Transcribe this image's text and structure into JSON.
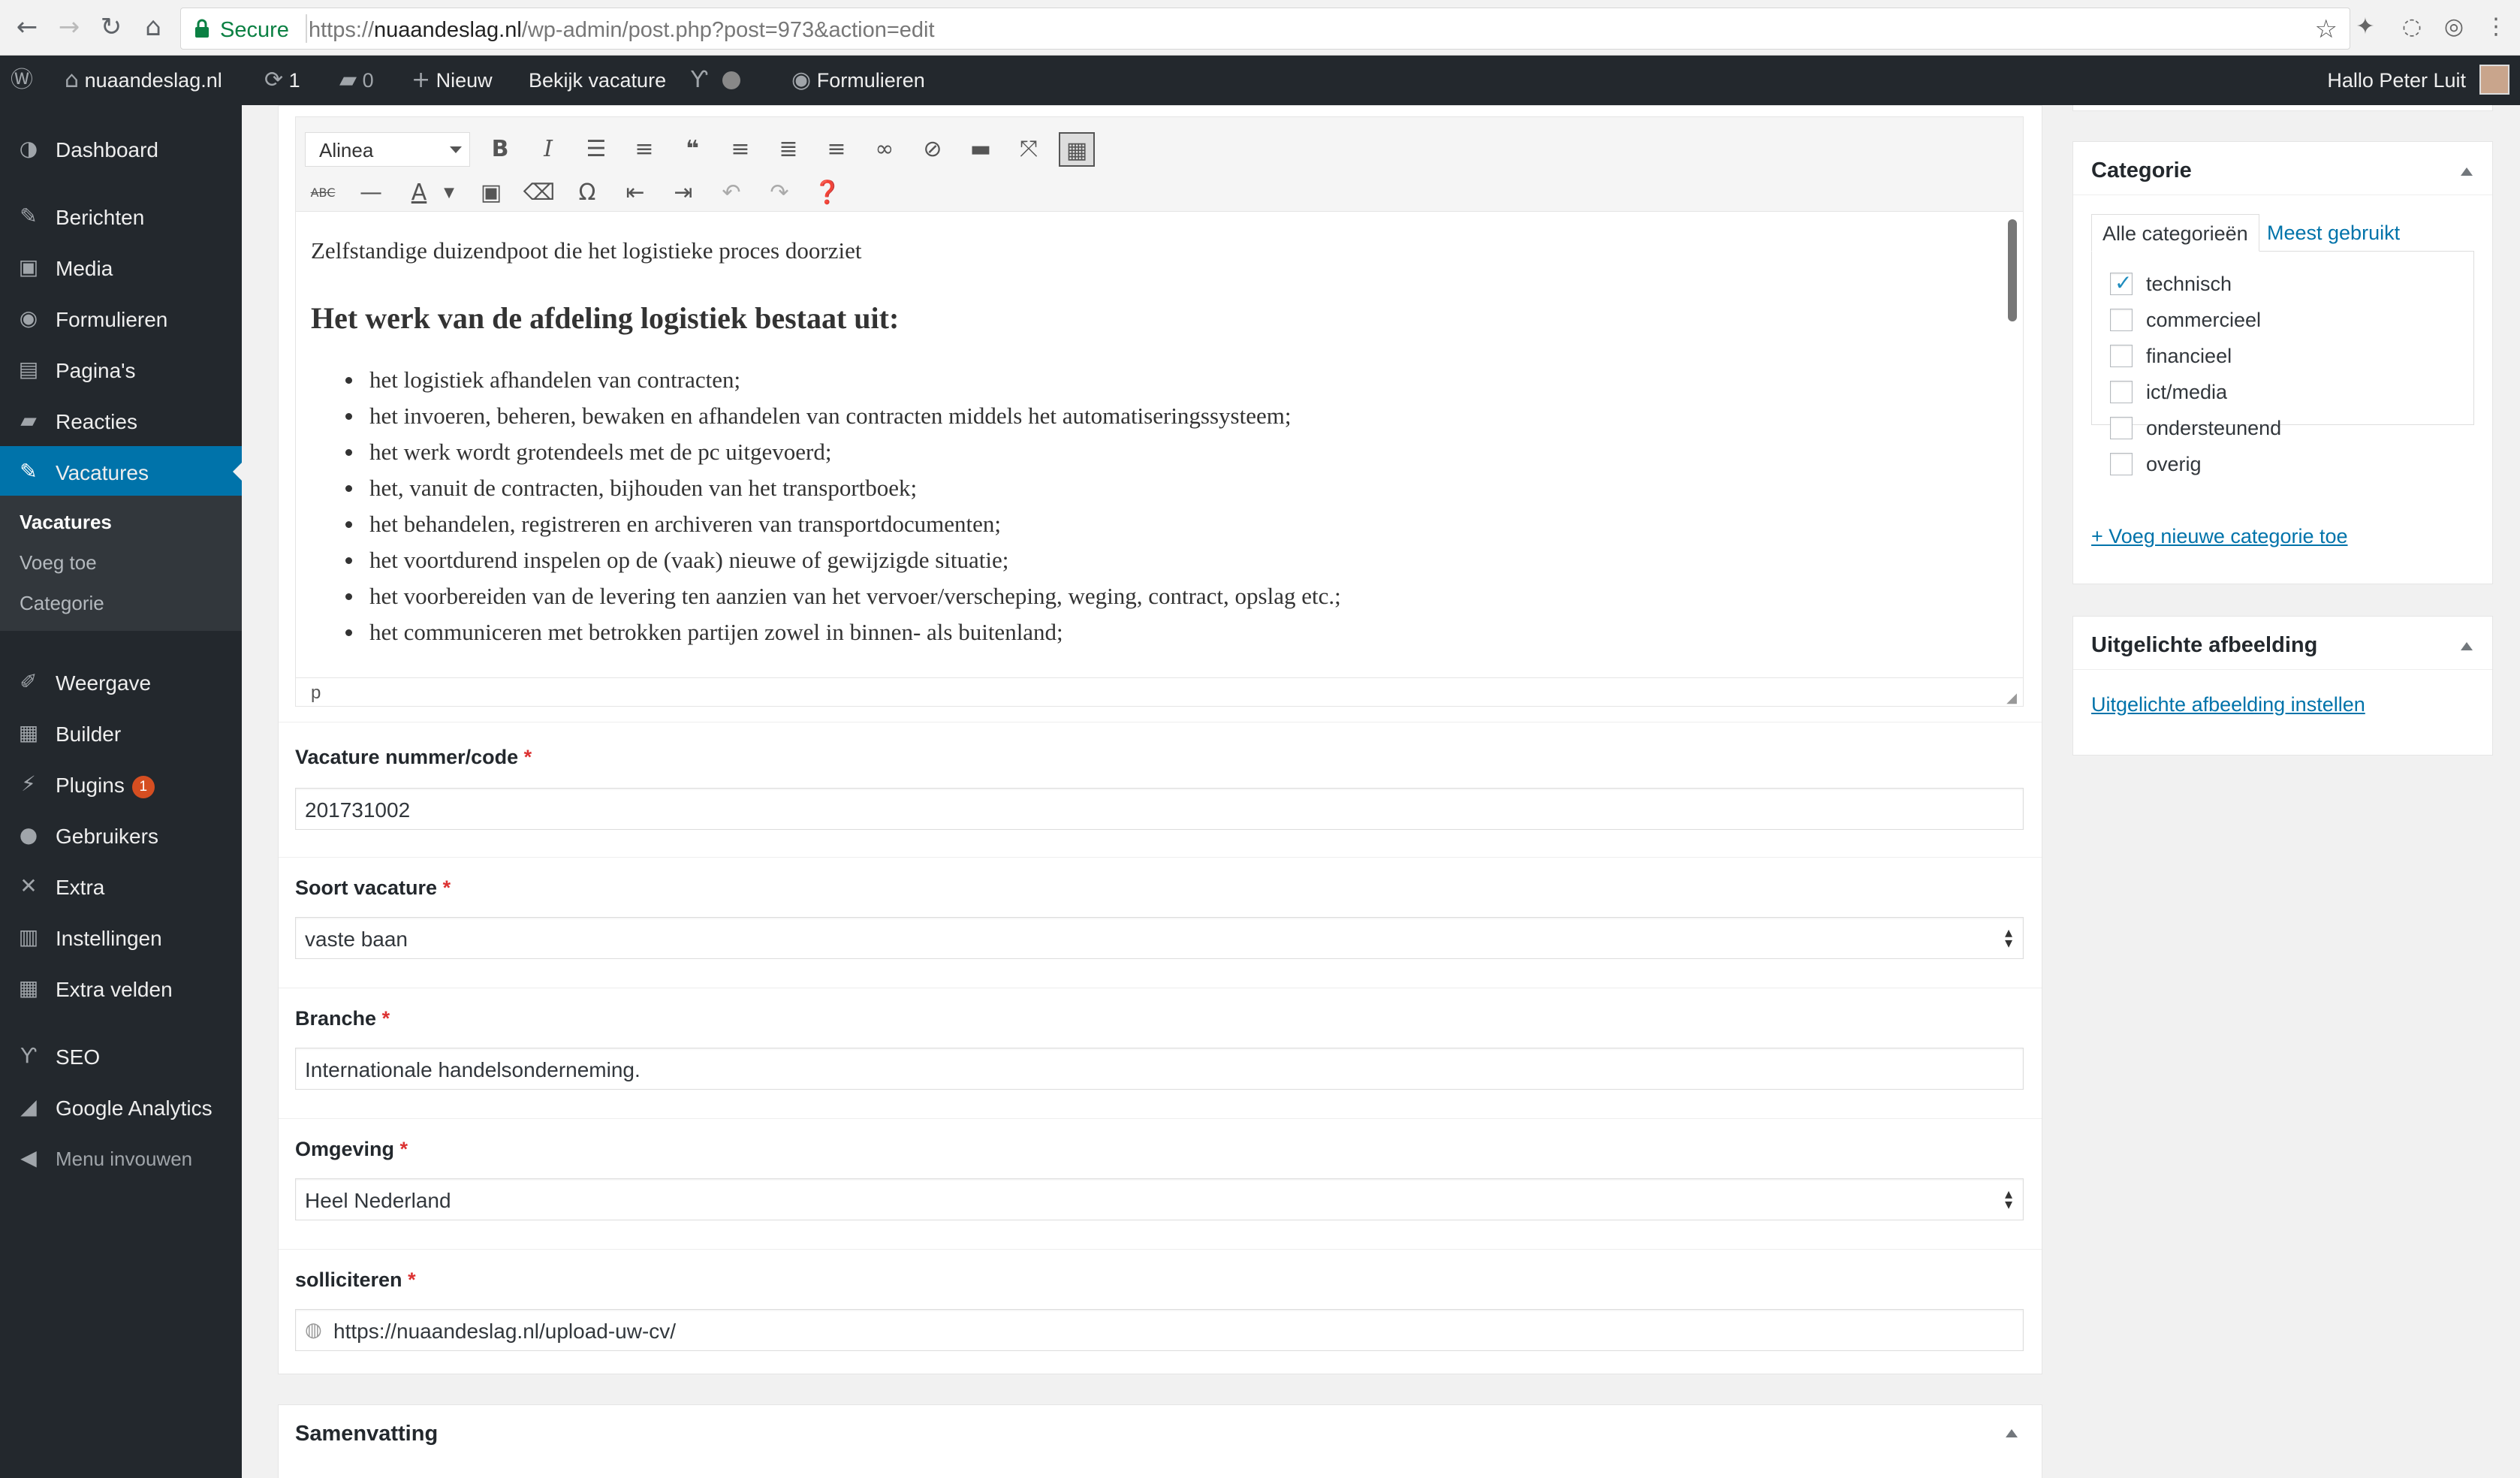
{
  "browser": {
    "secure_label": "Secure",
    "url_scheme": "https://",
    "url_host": "nuaandeslag.nl",
    "url_path": "/wp-admin/post.php?post=973&action=edit"
  },
  "adminbar": {
    "site_name": "nuaandeslag.nl",
    "updates_count": "1",
    "comments_count": "0",
    "new_label": "Nieuw",
    "view_label": "Bekijk vacature",
    "forms_label": "Formulieren",
    "greeting": "Hallo Peter Luit"
  },
  "sidebar": {
    "items": [
      {
        "label": "Dashboard",
        "icon": "dashboard-icon"
      },
      {
        "label": "Berichten",
        "icon": "pin-icon"
      },
      {
        "label": "Media",
        "icon": "media-icon"
      },
      {
        "label": "Formulieren",
        "icon": "forms-icon"
      },
      {
        "label": "Pagina's",
        "icon": "pages-icon"
      },
      {
        "label": "Reacties",
        "icon": "comments-icon"
      },
      {
        "label": "Vacatures",
        "icon": "pin-icon"
      },
      {
        "label": "Weergave",
        "icon": "appearance-icon"
      },
      {
        "label": "Builder",
        "icon": "builder-icon"
      },
      {
        "label": "Plugins",
        "icon": "plugins-icon",
        "badge": "1"
      },
      {
        "label": "Gebruikers",
        "icon": "users-icon"
      },
      {
        "label": "Extra",
        "icon": "tools-icon"
      },
      {
        "label": "Instellingen",
        "icon": "settings-icon"
      },
      {
        "label": "Extra velden",
        "icon": "fields-icon"
      },
      {
        "label": "SEO",
        "icon": "yoast-icon"
      },
      {
        "label": "Google Analytics",
        "icon": "analytics-icon"
      },
      {
        "label": "Menu invouwen",
        "icon": "collapse-icon"
      }
    ],
    "submenu": [
      "Vacatures",
      "Voeg toe",
      "Categorie"
    ]
  },
  "editor": {
    "format": "Alinea",
    "intro": "Zelfstandige duizendpoot die het logistieke proces doorziet",
    "heading": "Het werk van de afdeling logistiek bestaat uit:",
    "bullets": [
      "het logistiek afhandelen van contracten;",
      "het invoeren, beheren, bewaken en afhandelen van contracten middels het automatiseringssysteem;",
      "het werk wordt grotendeels met de pc uitgevoerd;",
      "het, vanuit de contracten, bijhouden van het transportboek;",
      "het behandelen, registreren en archiveren van transportdocumenten;",
      "het voortdurend inspelen op de (vaak) nieuwe of gewijzigde situatie;",
      "het voorbereiden van de levering ten aanzien van het vervoer/verscheping, weging, contract, opslag etc.;",
      "het communiceren met betrokken partijen zowel in binnen- als buitenland;"
    ],
    "path": "p"
  },
  "fields": {
    "code": {
      "label": "Vacature nummer/code",
      "value": "201731002"
    },
    "type": {
      "label": "Soort vacature",
      "value": "vaste baan"
    },
    "branche": {
      "label": "Branche",
      "value": "Internationale handelsonderneming."
    },
    "region": {
      "label": "Omgeving",
      "value": "Heel Nederland"
    },
    "apply": {
      "label": "solliciteren",
      "value": "https://nuaandeslag.nl/upload-uw-cv/"
    },
    "required_mark": "*"
  },
  "summary": {
    "title": "Samenvatting"
  },
  "category_box": {
    "title": "Categorie",
    "tab_all": "Alle categorieën",
    "tab_popular": "Meest gebruikt",
    "items": [
      {
        "label": "technisch",
        "checked": true
      },
      {
        "label": "commercieel",
        "checked": false
      },
      {
        "label": "financieel",
        "checked": false
      },
      {
        "label": "ict/media",
        "checked": false
      },
      {
        "label": "ondersteunend",
        "checked": false
      },
      {
        "label": "overig",
        "checked": false
      }
    ],
    "add_link": "+ Voeg nieuwe categorie toe"
  },
  "featured_box": {
    "title": "Uitgelichte afbeelding",
    "set_link": "Uitgelichte afbeelding instellen"
  },
  "colors": {
    "accent": "#0073aa",
    "sidebar": "#23282d",
    "required": "#dc3232"
  }
}
